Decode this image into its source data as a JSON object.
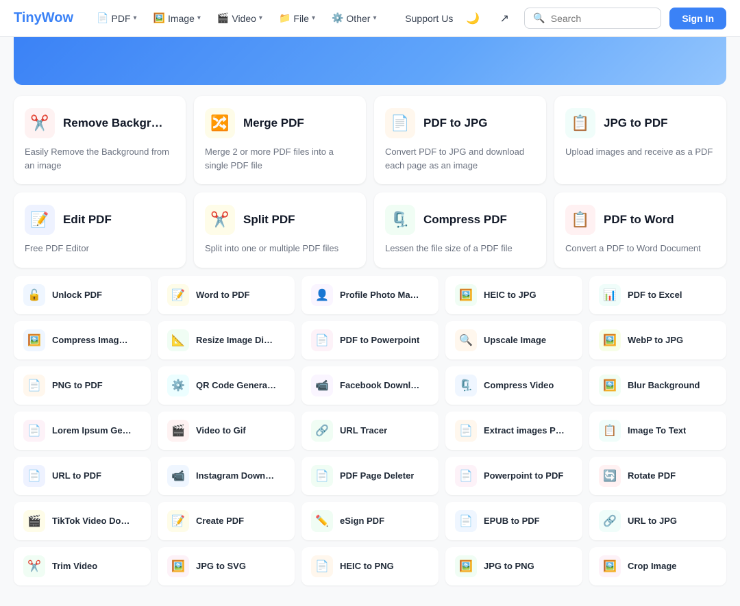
{
  "header": {
    "logo_tiny": "Tiny",
    "logo_wow": "Wow",
    "nav_items": [
      {
        "label": "PDF",
        "icon": "📄",
        "has_chevron": true
      },
      {
        "label": "Image",
        "icon": "🖼️",
        "has_chevron": true
      },
      {
        "label": "Video",
        "icon": "🎬",
        "has_chevron": true
      },
      {
        "label": "File",
        "icon": "📁",
        "has_chevron": true
      },
      {
        "label": "Other",
        "icon": "⚙️",
        "has_chevron": true
      }
    ],
    "support_label": "Support Us",
    "search_placeholder": "Search",
    "sign_in_label": "Sign In"
  },
  "featured_cards": [
    {
      "id": "remove-bg",
      "icon": "✂️",
      "icon_bg": "bg-red-light",
      "title": "Remove Backgr…",
      "desc": "Easily Remove the Background from an image"
    },
    {
      "id": "merge-pdf",
      "icon": "🔀",
      "icon_bg": "bg-yellow-light",
      "title": "Merge PDF",
      "desc": "Merge 2 or more PDF files into a single PDF file"
    },
    {
      "id": "pdf-to-jpg",
      "icon": "📄",
      "icon_bg": "bg-orange-light",
      "title": "PDF to JPG",
      "desc": "Convert PDF to JPG and download each page as an image"
    },
    {
      "id": "jpg-to-pdf",
      "icon": "📋",
      "icon_bg": "bg-teal-light",
      "title": "JPG to PDF",
      "desc": "Upload images and receive as a PDF"
    },
    {
      "id": "edit-pdf",
      "icon": "📝",
      "icon_bg": "bg-indigo-light",
      "title": "Edit PDF",
      "desc": "Free PDF Editor"
    },
    {
      "id": "split-pdf",
      "icon": "✂️",
      "icon_bg": "bg-yellow-light",
      "title": "Split PDF",
      "desc": "Split into one or multiple PDF files"
    },
    {
      "id": "compress-pdf",
      "icon": "🗜️",
      "icon_bg": "bg-green-light",
      "title": "Compress PDF",
      "desc": "Lessen the file size of a PDF file"
    },
    {
      "id": "pdf-to-word",
      "icon": "📋",
      "icon_bg": "bg-rose-light",
      "title": "PDF to Word",
      "desc": "Convert a PDF to Word Document"
    }
  ],
  "compact_rows": [
    [
      {
        "id": "unlock-pdf",
        "icon": "🔓",
        "icon_bg": "bg-blue-light",
        "label": "Unlock PDF"
      },
      {
        "id": "word-to-pdf",
        "icon": "📝",
        "icon_bg": "bg-yellow-light",
        "label": "Word to PDF"
      },
      {
        "id": "profile-photo-ma",
        "icon": "👤",
        "icon_bg": "bg-purple-light",
        "label": "Profile Photo Ma…"
      },
      {
        "id": "heic-to-jpg",
        "icon": "🖼️",
        "icon_bg": "bg-green-light",
        "label": "HEIC to JPG"
      },
      {
        "id": "pdf-to-excel",
        "icon": "📊",
        "icon_bg": "bg-teal-light",
        "label": "PDF to Excel"
      }
    ],
    [
      {
        "id": "compress-image",
        "icon": "🖼️",
        "icon_bg": "bg-blue-light",
        "label": "Compress Imag…"
      },
      {
        "id": "resize-image",
        "icon": "📐",
        "icon_bg": "bg-green-light",
        "label": "Resize Image Di…"
      },
      {
        "id": "pdf-to-ppt",
        "icon": "📄",
        "icon_bg": "bg-pink-light",
        "label": "PDF to Powerpoint"
      },
      {
        "id": "upscale-image",
        "icon": "🔍",
        "icon_bg": "bg-orange-light",
        "label": "Upscale Image"
      },
      {
        "id": "webp-to-jpg",
        "icon": "🖼️",
        "icon_bg": "bg-lime-light",
        "label": "WebP to JPG"
      }
    ],
    [
      {
        "id": "png-to-pdf",
        "icon": "📄",
        "icon_bg": "bg-orange-light",
        "label": "PNG to PDF"
      },
      {
        "id": "qr-code",
        "icon": "⚙️",
        "icon_bg": "bg-cyan-light",
        "label": "QR Code Genera…"
      },
      {
        "id": "facebook-dl",
        "icon": "📹",
        "icon_bg": "bg-purple-light",
        "label": "Facebook Downl…"
      },
      {
        "id": "compress-video",
        "icon": "🗜️",
        "icon_bg": "bg-blue-light",
        "label": "Compress Video"
      },
      {
        "id": "blur-bg",
        "icon": "🖼️",
        "icon_bg": "bg-green-light",
        "label": "Blur Background"
      }
    ],
    [
      {
        "id": "lorem-ipsum",
        "icon": "📄",
        "icon_bg": "bg-pink-light",
        "label": "Lorem Ipsum Ge…"
      },
      {
        "id": "video-to-gif",
        "icon": "🎬",
        "icon_bg": "bg-red-light",
        "label": "Video to Gif"
      },
      {
        "id": "url-tracer",
        "icon": "🔗",
        "icon_bg": "bg-green-light",
        "label": "URL Tracer"
      },
      {
        "id": "extract-images",
        "icon": "📄",
        "icon_bg": "bg-orange-light",
        "label": "Extract images P…"
      },
      {
        "id": "image-to-text",
        "icon": "📋",
        "icon_bg": "bg-teal-light",
        "label": "Image To Text"
      }
    ],
    [
      {
        "id": "url-to-pdf",
        "icon": "📄",
        "icon_bg": "bg-indigo-light",
        "label": "URL to PDF"
      },
      {
        "id": "instagram-dl",
        "icon": "📹",
        "icon_bg": "bg-blue-light",
        "label": "Instagram Down…"
      },
      {
        "id": "pdf-page-delete",
        "icon": "📄",
        "icon_bg": "bg-green-light",
        "label": "PDF Page Deleter"
      },
      {
        "id": "ppt-to-pdf",
        "icon": "📄",
        "icon_bg": "bg-pink-light",
        "label": "Powerpoint to PDF"
      },
      {
        "id": "rotate-pdf",
        "icon": "🔄",
        "icon_bg": "bg-rose-light",
        "label": "Rotate PDF"
      }
    ],
    [
      {
        "id": "tiktok-dl",
        "icon": "🎬",
        "icon_bg": "bg-yellow-light",
        "label": "TikTok Video Do…"
      },
      {
        "id": "create-pdf",
        "icon": "📝",
        "icon_bg": "bg-yellow-light",
        "label": "Create PDF"
      },
      {
        "id": "esign-pdf",
        "icon": "✏️",
        "icon_bg": "bg-green-light",
        "label": "eSign PDF"
      },
      {
        "id": "epub-to-pdf",
        "icon": "📄",
        "icon_bg": "bg-blue-light",
        "label": "EPUB to PDF"
      },
      {
        "id": "url-to-jpg",
        "icon": "🔗",
        "icon_bg": "bg-teal-light",
        "label": "URL to JPG"
      }
    ],
    [
      {
        "id": "trim-video",
        "icon": "✂️",
        "icon_bg": "bg-green-light",
        "label": "Trim Video"
      },
      {
        "id": "jpg-to-svg",
        "icon": "🖼️",
        "icon_bg": "bg-pink-light",
        "label": "JPG to SVG"
      },
      {
        "id": "heic-to-png",
        "icon": "📄",
        "icon_bg": "bg-orange-light",
        "label": "HEIC to PNG"
      },
      {
        "id": "jpg-to-png",
        "icon": "🖼️",
        "icon_bg": "bg-green-light",
        "label": "JPG to PNG"
      },
      {
        "id": "crop-image",
        "icon": "🖼️",
        "icon_bg": "bg-pink-light",
        "label": "Crop Image"
      }
    ]
  ]
}
